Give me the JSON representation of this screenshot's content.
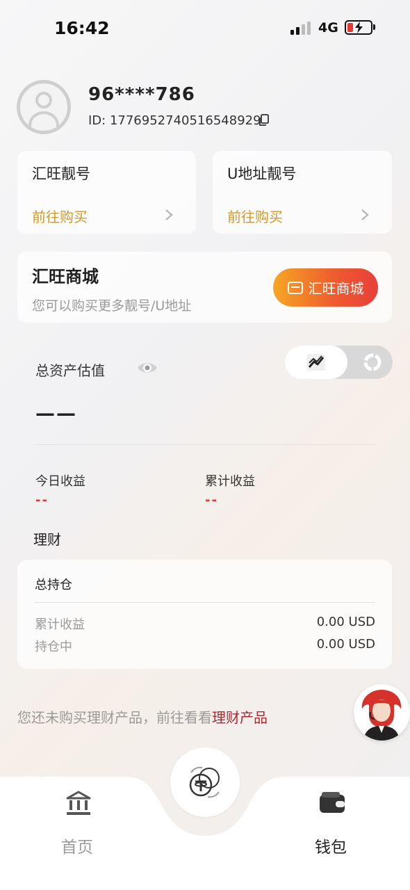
{
  "status_bar": {
    "time": "16:42",
    "network": "4G"
  },
  "profile": {
    "name": "96****786",
    "id_text": "ID: 1776952740516548929"
  },
  "cards": {
    "left": {
      "title": "汇旺靓号",
      "link": "前往购买"
    },
    "right": {
      "title": "U地址靓号",
      "link": "前往购买"
    }
  },
  "mall": {
    "title": "汇旺商城",
    "subtitle": "您可以购买更多靓号/U地址",
    "button_label": "汇旺商城"
  },
  "assets": {
    "label": "总资产估值",
    "value": "——",
    "today_label": "今日收益",
    "today_value": "--",
    "cumulative_label": "累计收益",
    "cumulative_value": "--"
  },
  "finance": {
    "title": "理财",
    "holdings_title": "总持仓",
    "rows": [
      {
        "label": "累计收益",
        "value": "0.00 USD"
      },
      {
        "label": "持仓中",
        "value": "0.00 USD"
      }
    ]
  },
  "notice": {
    "text": "您还未购买理财产品，前往看看",
    "link": "理财产品"
  },
  "bottom_nav": {
    "home_label": "首页",
    "wallet_label": "钱包"
  },
  "colors": {
    "accent_gold": "#d39a2a",
    "accent_red": "#e53935",
    "link_red": "#b3262d"
  }
}
